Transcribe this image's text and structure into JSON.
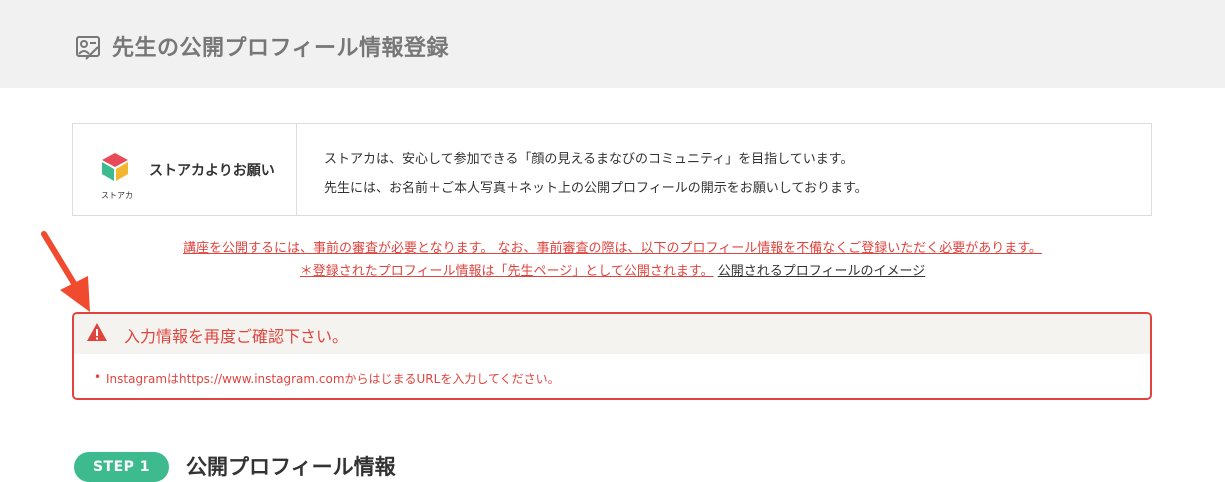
{
  "header": {
    "title": "先生の公開プロフィール情報登録",
    "icon": "profile-edit-icon"
  },
  "notice": {
    "logo_text": "ストアカ",
    "title": "ストアカよりお願い",
    "line1": "ストアカは、安心して参加できる「顔の見えるまなびのコミュニティ」を目指しています。",
    "line2": "先生には、お名前＋ご本人写真＋ネット上の公開プロフィールの開示をお願いしております。"
  },
  "warning": {
    "line1": "講座を公開するには、事前の審査が必要となります。 なお、事前審査の際は、以下のプロフィール情報を不備なくご登録いただく必要があります。",
    "line2": "＊登録されたプロフィール情報は「先生ページ」として公開されます。",
    "link": "公開されるプロフィールのイメージ"
  },
  "error": {
    "title": "入力情報を再度ご確認下さい。",
    "items": [
      "Instagramはhttps://www.instagram.comからはじまるURLを入力してください。"
    ],
    "color": "#e0443f"
  },
  "step": {
    "badge": "STEP 1",
    "title": "公開プロフィール情報",
    "color": "#3dbb8e"
  }
}
